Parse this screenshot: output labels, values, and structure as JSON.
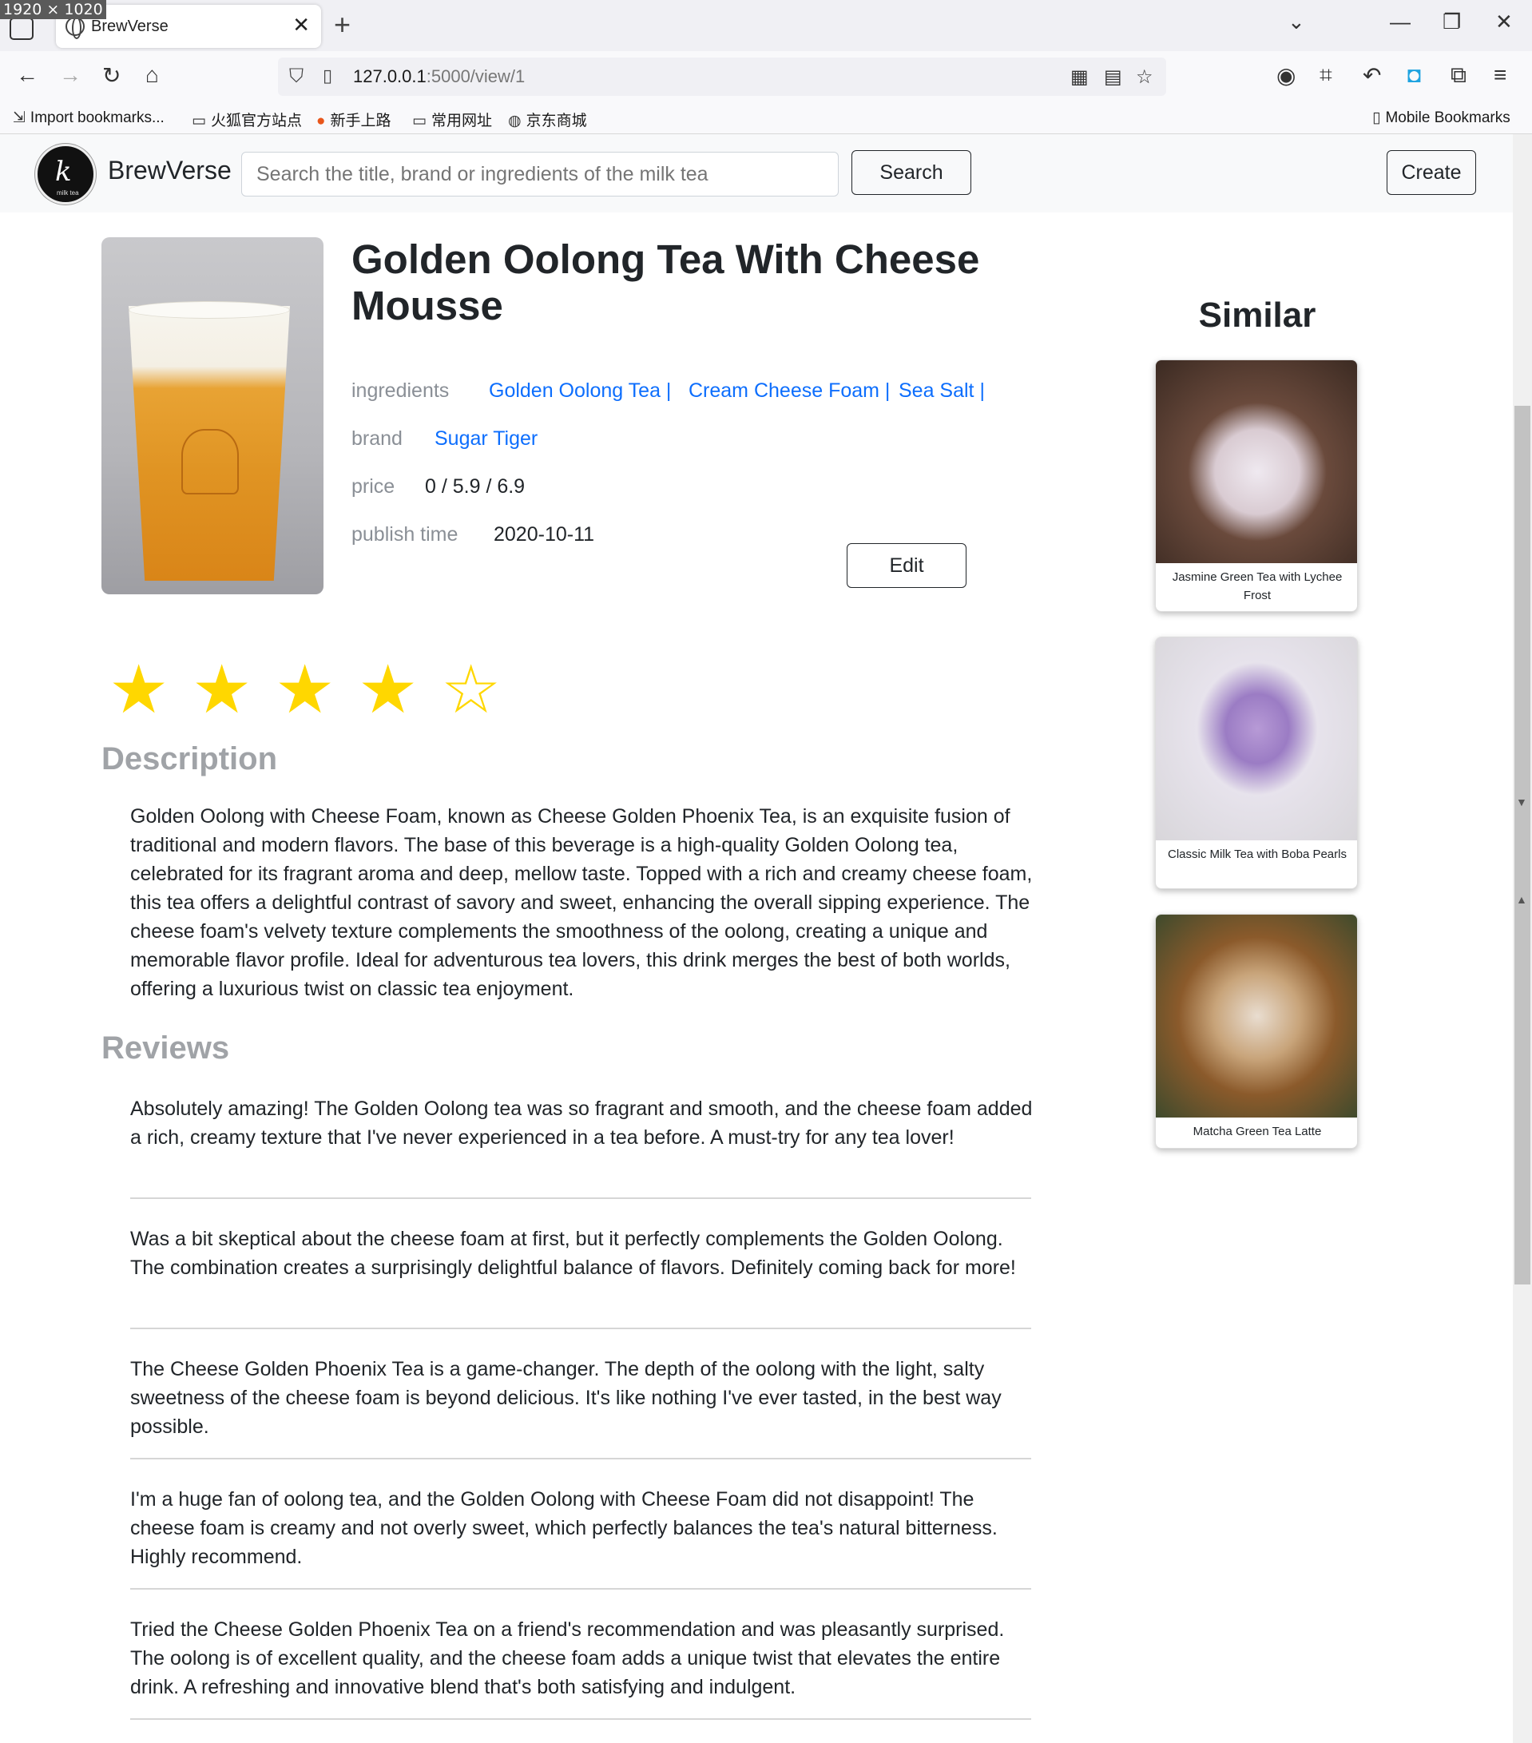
{
  "overlay": {
    "screen_size": "1920 × 1020"
  },
  "browser": {
    "tab_title": "BrewVerse",
    "tab_close": "✕",
    "new_tab": "+",
    "url_host": "127.0.0.1",
    "url_path": ":5000/view/1",
    "bookmarks": [
      {
        "icon": "import-icon",
        "label": "Import bookmarks..."
      },
      {
        "icon": "folder-icon",
        "label": "火狐官方站点"
      },
      {
        "icon": "firefox-icon",
        "label": "新手上路"
      },
      {
        "icon": "folder-icon",
        "label": "常用网址"
      },
      {
        "icon": "globe-icon",
        "label": "京东商城"
      }
    ],
    "mobile_bookmarks": "Mobile Bookmarks"
  },
  "header": {
    "brand": "BrewVerse",
    "logo_text": "milk tea",
    "search_placeholder": "Search the title, brand or ingredients of the milk tea",
    "search_button": "Search",
    "create_button": "Create"
  },
  "product": {
    "title": "Golden Oolong Tea With Cheese Mousse",
    "ingredients_label": "ingredients",
    "ingredients": [
      "Golden Oolong Tea |",
      "Cream Cheese Foam |",
      "Sea Salt |"
    ],
    "brand_label": "brand",
    "brand": "Sugar Tiger",
    "price_label": "price",
    "price": "0 / 5.9 / 6.9",
    "publish_label": "publish time",
    "publish_time": "2020-10-11",
    "edit_button": "Edit",
    "rating": 4,
    "rating_max": 5,
    "star_color": "#ffd700"
  },
  "description": {
    "heading": "Description",
    "text": "Golden Oolong with Cheese Foam, known as Cheese Golden Phoenix Tea, is an exquisite fusion of traditional and modern flavors. The base of this beverage is a high-quality Golden Oolong tea, celebrated for its fragrant aroma and deep, mellow taste. Topped with a rich and creamy cheese foam, this tea offers a delightful contrast of savory and sweet, enhancing the overall sipping experience. The cheese foam's velvety texture complements the smoothness of the oolong, creating a unique and memorable flavor profile. Ideal for adventurous tea lovers, this drink merges the best of both worlds, offering a luxurious twist on classic tea enjoyment."
  },
  "reviews": {
    "heading": "Reviews",
    "items": [
      "Absolutely amazing! The Golden Oolong tea was so fragrant and smooth, and the cheese foam added a rich, creamy texture that I've never experienced in a tea before. A must-try for any tea lover!",
      "Was a bit skeptical about the cheese foam at first, but it perfectly complements the Golden Oolong. The combination creates a surprisingly delightful balance of flavors. Definitely coming back for more!",
      "The Cheese Golden Phoenix Tea is a game-changer. The depth of the oolong with the light, salty sweetness of the cheese foam is beyond delicious. It's like nothing I've ever tasted, in the best way possible.",
      "I'm a huge fan of oolong tea, and the Golden Oolong with Cheese Foam did not disappoint! The cheese foam is creamy and not overly sweet, which perfectly balances the tea's natural bitterness. Highly recommend.",
      "Tried the Cheese Golden Phoenix Tea on a friend's recommendation and was pleasantly surprised. The oolong is of excellent quality, and the cheese foam adds a unique twist that elevates the entire drink. A refreshing and innovative blend that's both satisfying and indulgent."
    ]
  },
  "similar": {
    "heading": "Similar",
    "items": [
      {
        "label": "Jasmine Green Tea with Lychee Frost"
      },
      {
        "label": "Classic Milk Tea with Boba Pearls"
      },
      {
        "label": "Matcha Green Tea Latte"
      }
    ]
  }
}
